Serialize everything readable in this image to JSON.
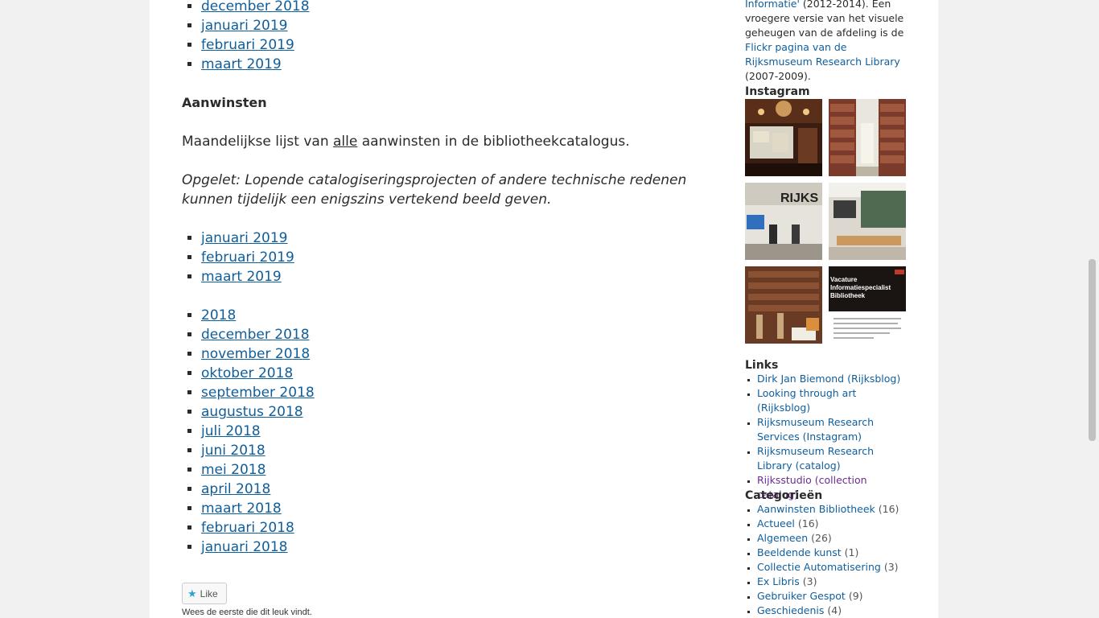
{
  "archive_top": [
    "december 2018",
    "januari 2019",
    "februari 2019",
    "maart 2019"
  ],
  "aanwinsten": {
    "heading": "Aanwinsten",
    "intro_before": "Maandelijkse lijst van ",
    "intro_link": "alle",
    "intro_after": " aanwinsten in de bibliotheekcatalogus.",
    "note": "Opgelet: Lopende catalogiseringsprojecten of andere technische redenen kunnen tijdelijk een enigszins vertekend beeld geven.",
    "months_2019": [
      "januari 2019",
      "februari 2019",
      "maart 2019"
    ],
    "months_2018": [
      "2018",
      "december 2018",
      "november 2018",
      "oktober 2018",
      "september 2018",
      "augustus 2018",
      "juli 2018",
      "juni 2018",
      "mei 2018",
      "april 2018",
      "maart 2018",
      "februari 2018",
      "januari 2018"
    ]
  },
  "like": {
    "button_label": "Like",
    "note": "Wees de eerste die dit leuk vindt."
  },
  "sidebar": {
    "archive_text": {
      "link1": "Informatie'",
      "text1": " (2012-2014). Een vroegere versie van het visuele geheugen van de afdeling is de ",
      "link2": "Flickr pagina van de Rijksmuseum Research Library",
      "text2": " (2007-2009)."
    },
    "instagram_title": "Instagram",
    "instagram_tiles": [
      {
        "icon": "lecture-projection-photo"
      },
      {
        "icon": "library-shelves-photo"
      },
      {
        "icon": "rijks-presentation-photo"
      },
      {
        "icon": "reading-room-photo"
      },
      {
        "icon": "cuypers-library-photo"
      },
      {
        "icon": "vacancy-post",
        "text": "Vacature Informatiespecialist Bibliotheek"
      }
    ],
    "links_title": "Links",
    "links": [
      {
        "label": "Dirk Jan Biemond (Rijksblog)",
        "visited": false
      },
      {
        "label": "Looking through art (Rijksblog)",
        "visited": false
      },
      {
        "label": "Rijksmuseum Research Services (Instagram)",
        "visited": false
      },
      {
        "label": "Rijksmuseum Research Library (catalog)",
        "visited": false
      },
      {
        "label": "Rijksstudio (collection catalog)",
        "visited": true
      }
    ],
    "categories_title": "Categorieën",
    "categories": [
      {
        "label": "Aanwinsten Bibliotheek",
        "count": "(16)"
      },
      {
        "label": "Actueel",
        "count": "(16)"
      },
      {
        "label": "Algemeen",
        "count": "(26)"
      },
      {
        "label": "Beeldende kunst",
        "count": "(1)"
      },
      {
        "label": "Collectie Automatisering",
        "count": "(3)"
      },
      {
        "label": "Ex Libris",
        "count": "(3)"
      },
      {
        "label": "Gebruiker Gespot",
        "count": "(9)"
      },
      {
        "label": "Geschiedenis",
        "count": "(4)"
      }
    ]
  },
  "colors": {
    "link": "#0f5e9c",
    "visited": "#6b2c91",
    "text": "#2b2b2b",
    "background": "#f1f1f1"
  }
}
